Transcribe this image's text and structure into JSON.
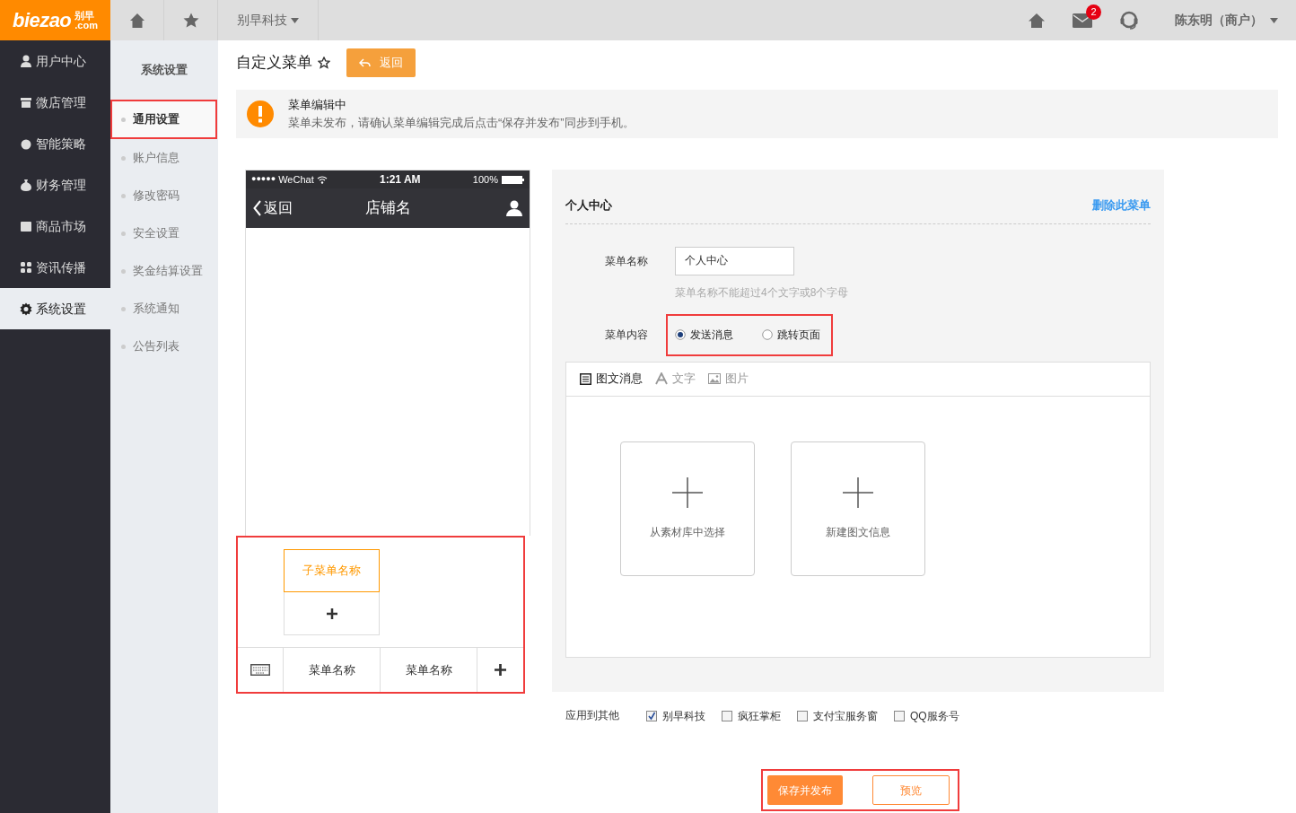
{
  "logo": {
    "brand": "biezao",
    "cn": "别早",
    "domain": ".com"
  },
  "topbar": {
    "company": "别早科技",
    "mail_count": "2",
    "user": "陈东明（商户）"
  },
  "nav": [
    {
      "label": "用户中心",
      "selected": false,
      "kind": "user"
    },
    {
      "label": "微店管理",
      "selected": false,
      "kind": "shop"
    },
    {
      "label": "智能策略",
      "selected": false,
      "kind": "bulb"
    },
    {
      "label": "财务管理",
      "selected": false,
      "kind": "money"
    },
    {
      "label": "商品市场",
      "selected": false,
      "kind": "bag"
    },
    {
      "label": "资讯传播",
      "selected": false,
      "kind": "grid"
    },
    {
      "label": "系统设置",
      "selected": true,
      "kind": "gear"
    }
  ],
  "subnav": {
    "title": "系统设置",
    "items": [
      {
        "label": "通用设置",
        "selected": true
      },
      {
        "label": "账户信息",
        "selected": false
      },
      {
        "label": "修改密码",
        "selected": false
      },
      {
        "label": "安全设置",
        "selected": false
      },
      {
        "label": "奖金结算设置",
        "selected": false
      },
      {
        "label": "系统通知",
        "selected": false
      },
      {
        "label": "公告列表",
        "selected": false
      }
    ]
  },
  "page": {
    "title": "自定义菜单",
    "back_button": "返回"
  },
  "alert": {
    "title": "菜单编辑中",
    "message": "菜单未发布，请确认菜单编辑完成后点击“保存并发布”同步到手机。"
  },
  "phone": {
    "signal": "●●●●●",
    "carrier": "WeChat",
    "time": "1:21 AM",
    "battery": "100%",
    "back": "返回",
    "title": "店铺名",
    "submenu": [
      {
        "label": "子菜单名称",
        "selected": true
      }
    ],
    "menus": [
      {
        "label": "菜单名称"
      },
      {
        "label": "菜单名称"
      }
    ]
  },
  "editor": {
    "heading": "个人中心",
    "delete_link": "删除此菜单",
    "name_label": "菜单名称",
    "name_value": "个人中心",
    "name_hint": "菜单名称不能超过4个文字或8个字母",
    "content_label": "菜单内容",
    "radios": [
      {
        "label": "发送消息",
        "selected": true
      },
      {
        "label": "跳转页面",
        "selected": false
      }
    ],
    "tabs": [
      {
        "label": "图文消息",
        "selected": true,
        "kind": "list"
      },
      {
        "label": "文字",
        "selected": false,
        "kind": "text"
      },
      {
        "label": "图片",
        "selected": false,
        "kind": "image"
      }
    ],
    "tiles": [
      "从素材库中选择",
      "新建图文信息"
    ]
  },
  "apply": {
    "label": "应用到其他",
    "options": [
      {
        "label": "别早科技",
        "checked": true
      },
      {
        "label": "疯狂掌柜",
        "checked": false
      },
      {
        "label": "支付宝服务窗",
        "checked": false
      },
      {
        "label": "QQ服务号",
        "checked": false
      }
    ]
  },
  "actions": {
    "save": "保存并发布",
    "preview": "预览"
  }
}
